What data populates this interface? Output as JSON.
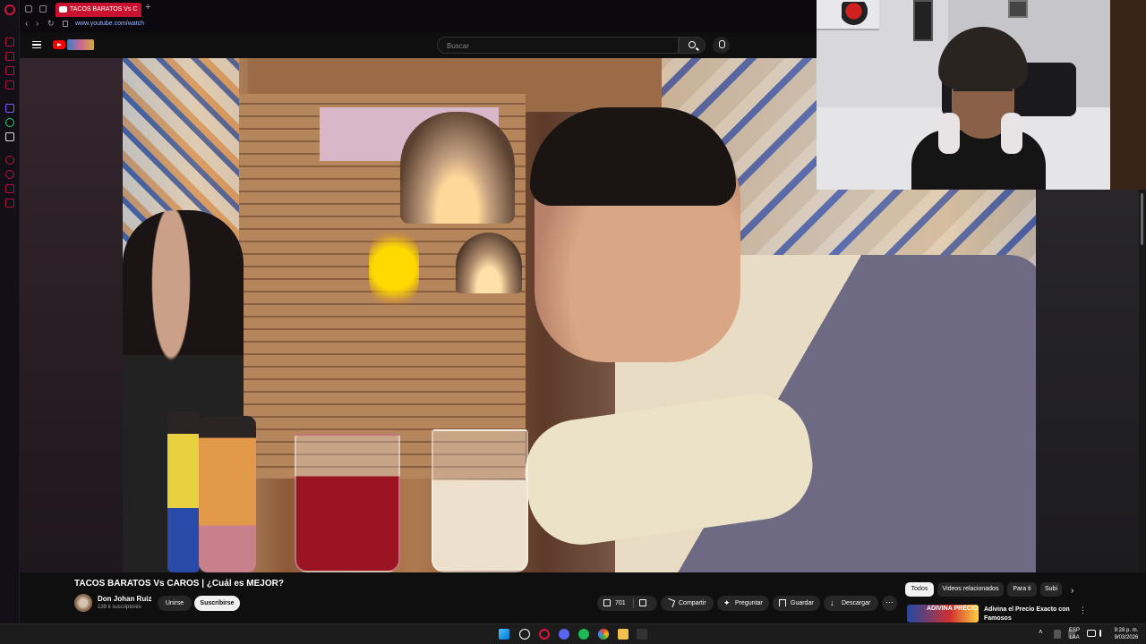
{
  "browser": {
    "tab_title": "TACOS BARATOS Vs C",
    "new_tab": "+",
    "url": "www.youtube.com/watch"
  },
  "youtube": {
    "search_placeholder": "Buscar"
  },
  "video": {
    "title": "TACOS BARATOS Vs CAROS | ¿Cuál es MEJOR?",
    "channel_name": "Don Johan Ruiz",
    "subscribers": "139 k suscriptores",
    "join_label": "Unirse",
    "subscribe_label": "Suscribirse",
    "likes": "701",
    "share_label": "Compartir",
    "ask_label": "Preguntar",
    "save_label": "Guardar",
    "download_label": "Descargar",
    "more_label": "⋯"
  },
  "sidebar_chips": [
    "Todos",
    "Videos relacionados",
    "Para ti",
    "Subi"
  ],
  "recommendation": {
    "thumb_text": "ADIVINA PRECIO",
    "title": "Adivina el Precio Exacto con Famosos"
  },
  "taskbar": {
    "language_top": "ESP",
    "language_bottom": "LAA",
    "time": "9:28 p. m.",
    "date": "9/03/2026"
  },
  "colors": {
    "opera_accent": "#c81230",
    "youtube_red": "#ff0000",
    "background": "#0f0f0f"
  }
}
